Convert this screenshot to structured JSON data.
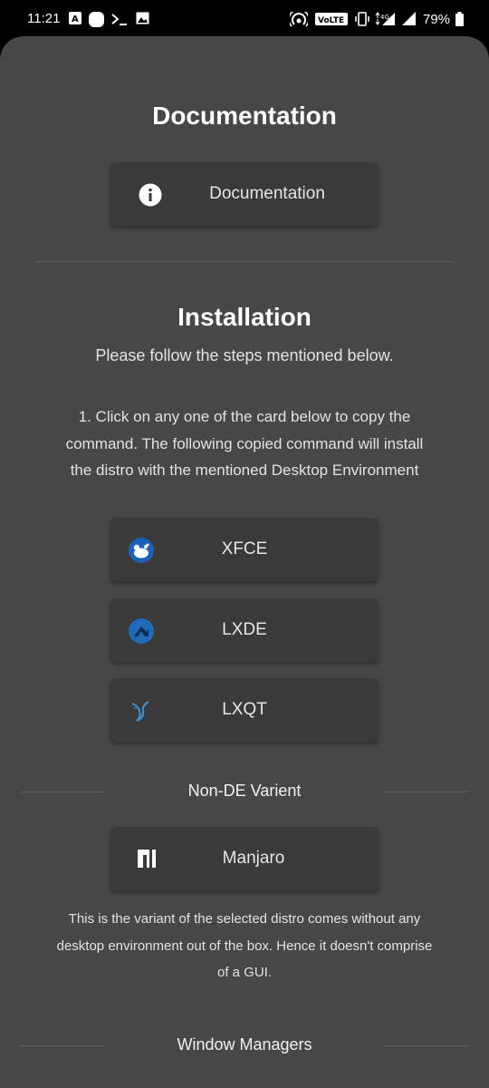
{
  "status_bar": {
    "time": "11:21",
    "battery": "79%",
    "network_label": "VoLTE 1",
    "network_type": "4G"
  },
  "documentation": {
    "heading": "Documentation",
    "button_label": "Documentation"
  },
  "installation": {
    "heading": "Installation",
    "subheading": "Please follow the steps mentioned below.",
    "step1_lines": [
      "1. Click on any one of the card below to copy the",
      "command. The following copied command will install",
      "the distro with the mentioned Desktop Environment"
    ],
    "desktop_cards": [
      {
        "label": "XFCE",
        "icon": "xfce-logo-icon"
      },
      {
        "label": "LXDE",
        "icon": "lxde-logo-icon"
      },
      {
        "label": "LXQT",
        "icon": "lxqt-logo-icon"
      }
    ]
  },
  "non_de": {
    "heading": "Non-DE Varient",
    "card_label": "Manjaro",
    "card_icon": "manjaro-logo-icon",
    "description_lines": [
      "This is the variant of the selected distro comes without any",
      "desktop environment out of the box. Hence it doesn't comprise",
      "of a GUI."
    ]
  },
  "window_managers": {
    "heading": "Window Managers"
  },
  "colors": {
    "sheet_background": "#474747",
    "card_background": "#3a3a3a",
    "manjaro_green": "#ffffff",
    "xfce_blue": "#1d61b6",
    "lxde_blue": "#1f6bb8"
  }
}
